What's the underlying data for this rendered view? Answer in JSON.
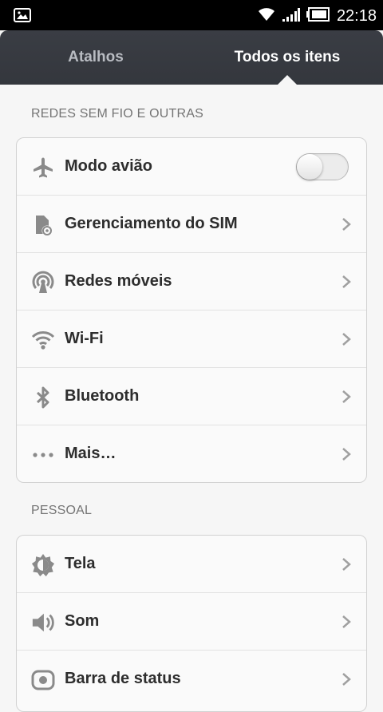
{
  "status_bar": {
    "time": "22:18",
    "icons": [
      "image-notification-icon",
      "wifi-icon",
      "signal-icon",
      "battery-icon"
    ]
  },
  "tabs": [
    {
      "label": "Atalhos",
      "selected": false
    },
    {
      "label": "Todos os itens",
      "selected": true
    }
  ],
  "sections": {
    "wireless": {
      "title": "REDES SEM FIO E OUTRAS",
      "items": [
        {
          "label": "Modo avião",
          "icon": "airplane-icon",
          "control": "toggle",
          "toggle_on": false
        },
        {
          "label": "Gerenciamento do SIM",
          "icon": "sim-card-icon",
          "control": "chevron"
        },
        {
          "label": "Redes móveis",
          "icon": "mobile-network-icon",
          "control": "chevron"
        },
        {
          "label": "Wi-Fi",
          "icon": "wifi-icon",
          "control": "chevron"
        },
        {
          "label": "Bluetooth",
          "icon": "bluetooth-icon",
          "control": "chevron"
        },
        {
          "label": "Mais…",
          "icon": "more-dots-icon",
          "control": "chevron"
        }
      ]
    },
    "personal": {
      "title": "PESSOAL",
      "items": [
        {
          "label": "Tela",
          "icon": "brightness-icon",
          "control": "chevron"
        },
        {
          "label": "Som",
          "icon": "speaker-icon",
          "control": "chevron"
        },
        {
          "label": "Barra de status",
          "icon": "status-bar-icon",
          "control": "chevron"
        }
      ]
    }
  },
  "colors": {
    "tab_bar": "#373a40",
    "background": "#f6f6f6",
    "card": "#fafafa",
    "label": "#2d2d2d",
    "icon": "#8a8a8a",
    "section_title": "#747474"
  }
}
